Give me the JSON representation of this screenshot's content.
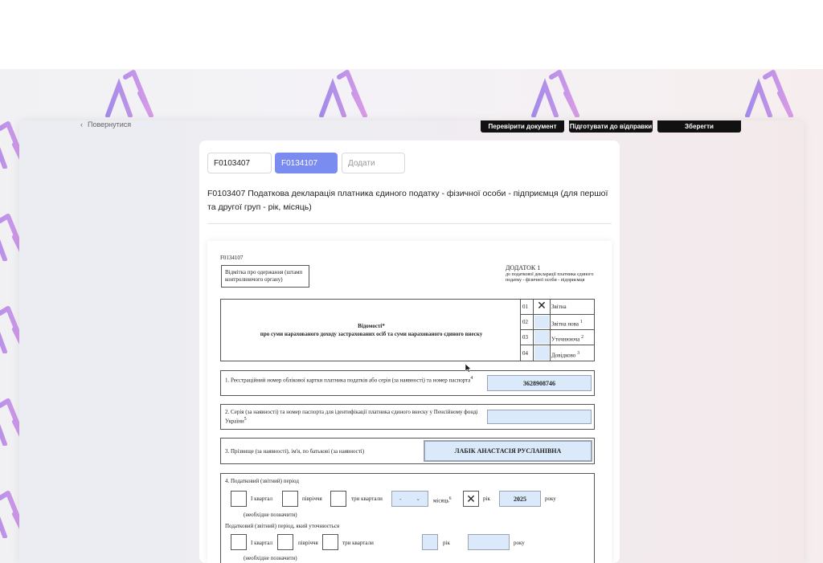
{
  "toolbar": {
    "back_label": "Повернутися",
    "check_label": "Перевірити документ",
    "prepare_label": "Підготувати до відправки",
    "save_label": "Зберегти"
  },
  "tabs": [
    {
      "label": "F0103407"
    },
    {
      "label": "F0134107"
    },
    {
      "label": "Додати"
    }
  ],
  "doc_title": "F0103407 Податкова декларація платника єдиного податку - фізичної особи - підприємця (для першої та другої груп - рік, місяць)",
  "form": {
    "code": "F0134107",
    "receipt_mark": "Відмітка про одержання (штамп контролюючого органу)",
    "annex_title": "ДОДАТОК 1",
    "annex_sub": "до податкової декларації платника єдиного податку - фізичної особи - підприємця",
    "heading_1": "Відомості*",
    "heading_2": "про суми нарахованого доходу застрахованих осіб та суми нарахованого єдиного внеску",
    "types": [
      {
        "code": "01",
        "label": "Звітна",
        "sup": "",
        "checked": "✕"
      },
      {
        "code": "02",
        "label": "Звітна нова",
        "sup": "1",
        "checked": ""
      },
      {
        "code": "03",
        "label": "Уточнююча",
        "sup": "2",
        "checked": ""
      },
      {
        "code": "04",
        "label": "Довідково",
        "sup": "3",
        "checked": ""
      }
    ],
    "field1_label": "1. Реєстраційний номер облікової картки платника податків або серія (за наявності) та номер паспорта",
    "field1_sup": "4",
    "field1_value": "3628908746",
    "field2_label": "2. Серія (за наявності) та номер паспорта для ідентифікації платника єдиного внеску у Пенсійному фонді України",
    "field2_sup": "5",
    "field2_value": "",
    "field3_label": "3. Прізвище (за наявності), ім'я, по батькові (за наявності)",
    "field3_value": "ЛАБІК АНАСТАСІЯ РУСЛАНІВНА",
    "period_label": "4. Податковий (звітний) період",
    "q1": "І квартал",
    "half": "півріччя",
    "q3": "три квартали",
    "month_select": "-",
    "month_label": "місяць",
    "month_sup": "6",
    "year_mark": "✕",
    "year_label": "рік",
    "year_value": "2025",
    "year_suffix": "року",
    "note": "(необхідне позначити)",
    "clarified_label": "Податковий (звітний) період, який уточнюється",
    "q1b": "І квартал",
    "halfb": "півріччя",
    "q3b": "три квартали",
    "year_label_b": "рік",
    "year_suffix_b": "року",
    "note_b": "(необхідне позначити)"
  },
  "colors": {
    "accent": "#7b8cf0",
    "field_fill": "#dbeafb",
    "watermark": "#9b7fe0"
  }
}
